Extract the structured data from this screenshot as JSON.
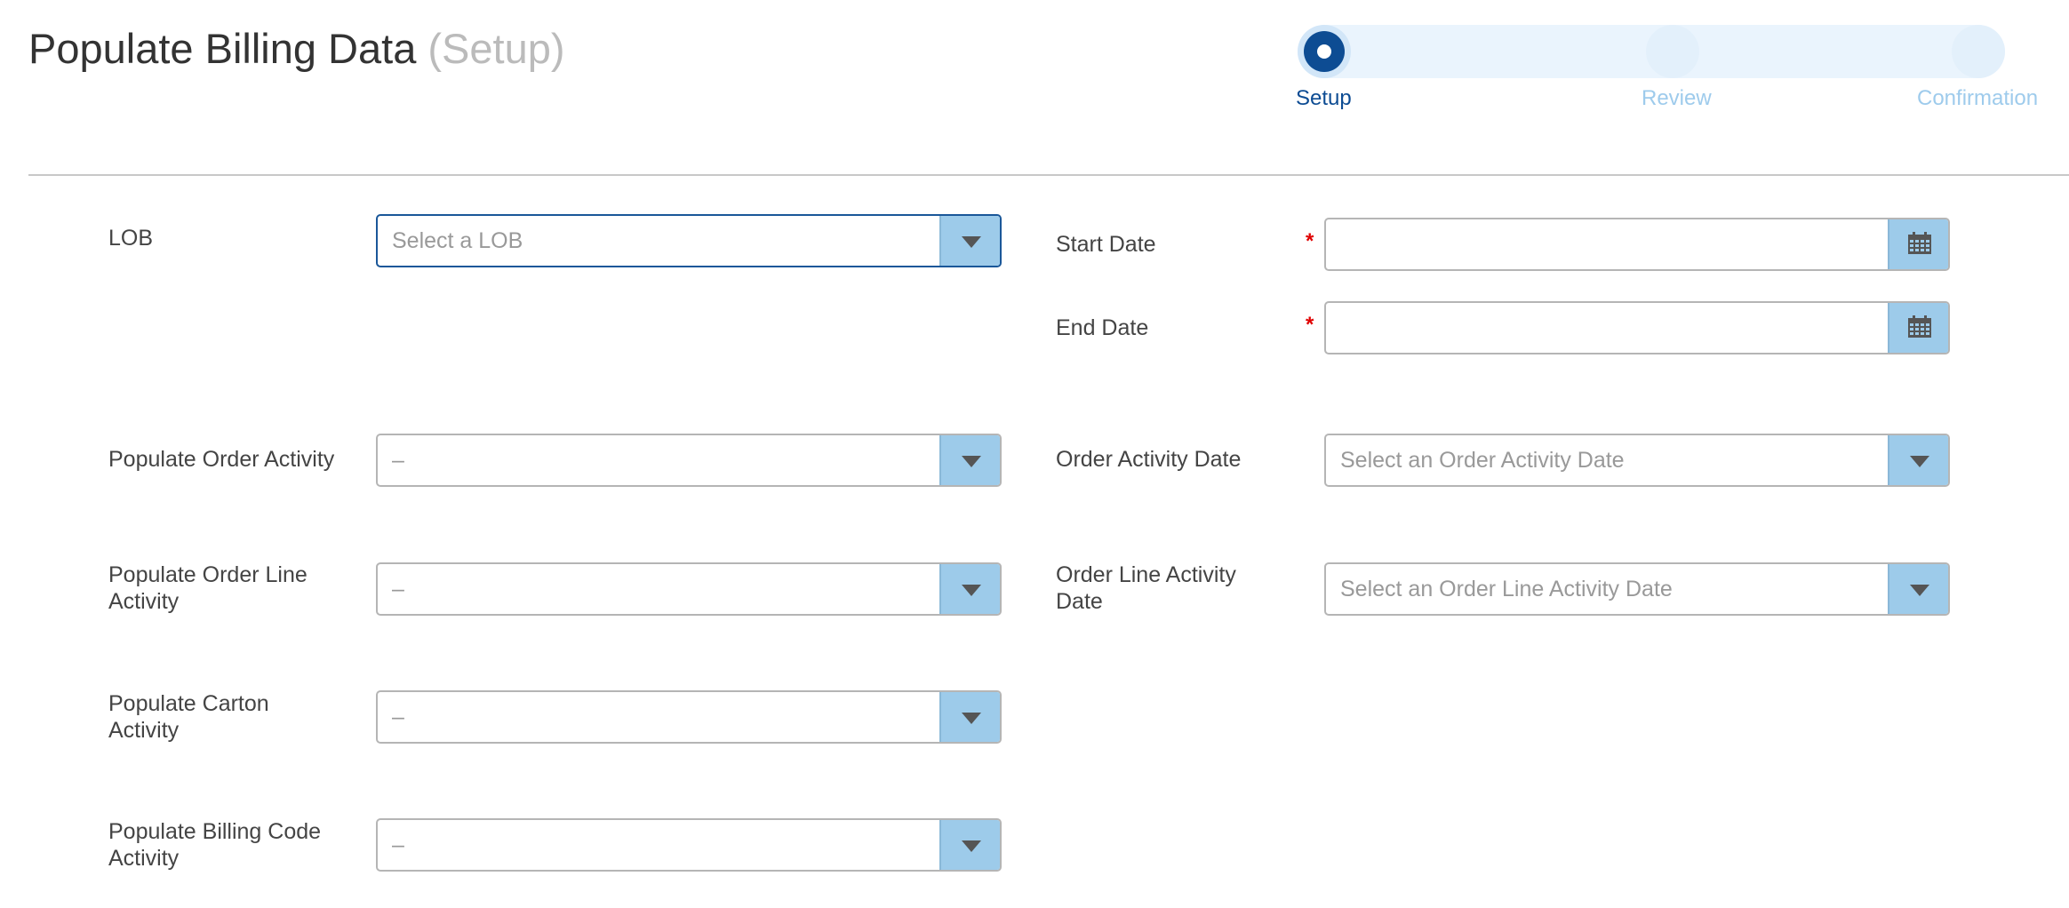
{
  "header": {
    "title": "Populate Billing Data",
    "subtitle": "(Setup)"
  },
  "stepper": {
    "steps": [
      {
        "label": "Setup",
        "state": "active"
      },
      {
        "label": "Review",
        "state": "pending"
      },
      {
        "label": "Confirmation",
        "state": "pending"
      }
    ]
  },
  "form": {
    "lob": {
      "label": "LOB",
      "placeholder": "Select a LOB"
    },
    "start_date": {
      "label": "Start Date",
      "required_mark": "*",
      "value": ""
    },
    "end_date": {
      "label": "End Date",
      "required_mark": "*",
      "value": ""
    },
    "populate_order_activity": {
      "label": "Populate Order Activity",
      "value": "–"
    },
    "order_activity_date": {
      "label": "Order Activity Date",
      "placeholder": "Select an Order Activity Date"
    },
    "populate_order_line_activity": {
      "label_line1": "Populate Order Line",
      "label_line2": "Activity",
      "value": "–"
    },
    "order_line_activity_date": {
      "label_line1": "Order Line Activity",
      "label_line2": "Date",
      "placeholder": "Select an Order Line Activity Date"
    },
    "populate_carton_activity": {
      "label_line1": "Populate Carton",
      "label_line2": "Activity",
      "value": "–"
    },
    "populate_billing_code_activity": {
      "label_line1": "Populate Billing Code",
      "label_line2": "Activity",
      "value": "–"
    }
  },
  "colors": {
    "accent": "#0d4c93",
    "dropdown_button": "#9dcbea",
    "required": "#e00000",
    "pending_step": "#9ecbec"
  },
  "icons": {
    "dropdown": "chevron-down-icon",
    "date_picker": "calendar-icon"
  }
}
